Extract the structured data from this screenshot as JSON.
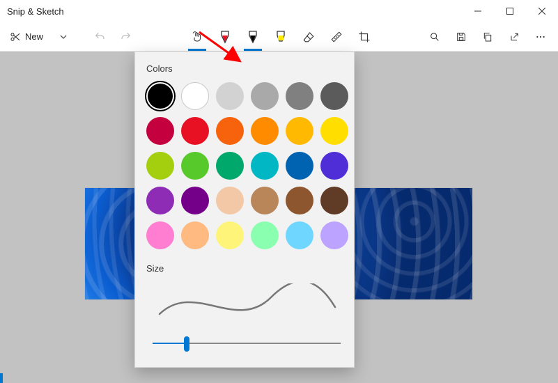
{
  "window": {
    "title": "Snip & Sketch"
  },
  "toolbar": {
    "new_label": "New"
  },
  "popover": {
    "colors_heading": "Colors",
    "size_heading": "Size",
    "selected_index": 0,
    "slider_percent": 18,
    "swatches": [
      "#000000",
      "#ffffff",
      "#d2d2d2",
      "#a9a9a9",
      "#808080",
      "#5b5b5b",
      "#c5003e",
      "#e81123",
      "#f7630c",
      "#ff8c00",
      "#ffb900",
      "#ffde00",
      "#a4cf0e",
      "#57c92b",
      "#00a86b",
      "#00b7c3",
      "#0063b1",
      "#4f2ed8",
      "#8e2cb5",
      "#740089",
      "#f3c8a7",
      "#b88659",
      "#8e562e",
      "#603b26",
      "#ff7ed1",
      "#ffba81",
      "#fff47a",
      "#8bffb0",
      "#6ed6ff",
      "#bba3ff"
    ]
  }
}
